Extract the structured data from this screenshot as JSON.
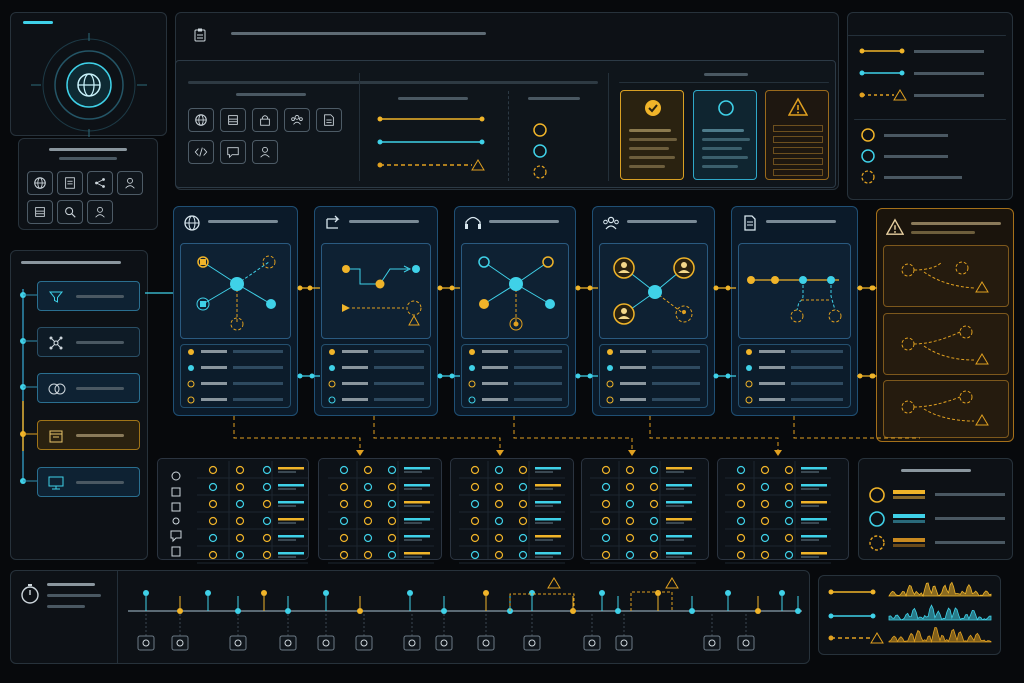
{
  "colors": {
    "accent_cyan": "#3fd1e8",
    "accent_amber": "#f0b429",
    "warning": "#e0a020",
    "panel_bg": "#0d1116",
    "border": "#27323b"
  },
  "top_left_widget": {
    "icon": "globe-icon"
  },
  "tool_grid_left": {
    "icons": [
      "globe-icon",
      "document-icon",
      "share-icon",
      "user-icon",
      "server-icon",
      "search-icon",
      "user-icon"
    ]
  },
  "sidebar_pipeline": {
    "items": [
      "filter-icon",
      "network-icon",
      "rings-icon",
      "calendar-icon",
      "monitor-icon"
    ],
    "active_index": 3
  },
  "header": {
    "icon": "clipboard-icon"
  },
  "toolbar": {
    "icons": [
      "globe-icon",
      "server-icon",
      "lock-icon",
      "users-icon",
      "document-icon",
      "code-icon",
      "chat-icon",
      "user-icon"
    ]
  },
  "legend_lines": [
    "solid-amber",
    "solid-cyan",
    "dashed-warning"
  ],
  "status_cards": [
    {
      "icon": "check-icon",
      "status": "success",
      "color": "#f0b429"
    },
    {
      "icon": "circle-icon",
      "status": "info",
      "color": "#3fd1e8"
    },
    {
      "icon": "warning-icon",
      "status": "warning",
      "color": "#e0a020"
    }
  ],
  "workflow_stages": [
    {
      "icon": "globe-icon"
    },
    {
      "icon": "redirect-icon"
    },
    {
      "icon": "headset-icon"
    },
    {
      "icon": "users-icon"
    },
    {
      "icon": "document-icon"
    }
  ],
  "alert_panel": {
    "icon": "warning-icon"
  },
  "timeline": {
    "icon": "stopwatch-icon",
    "event_icons": [
      "globe-icon",
      "server-icon",
      "lock-icon",
      "users-icon",
      "search-icon",
      "chat-icon",
      "user-icon",
      "lock-icon",
      "share-icon",
      "document-icon",
      "users-icon",
      "chat-icon",
      "user-icon",
      "document-icon"
    ]
  },
  "table_row_icons": [
    "globe-icon",
    "server-icon",
    "document-icon",
    "users-icon",
    "chat-icon",
    "document-icon"
  ]
}
